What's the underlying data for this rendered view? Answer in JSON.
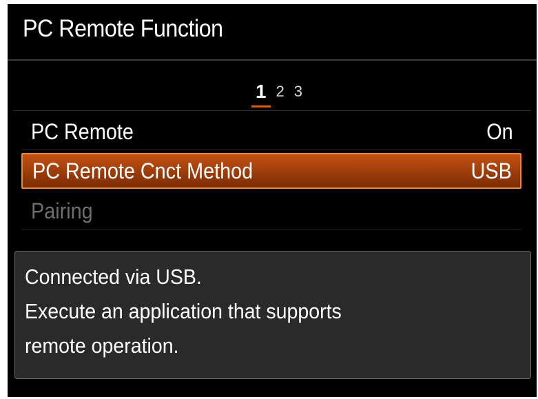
{
  "header": {
    "title": "PC Remote Function"
  },
  "pagination": {
    "pages": [
      "1",
      "2",
      "3"
    ],
    "active_page": "1"
  },
  "menu": {
    "items": [
      {
        "label": "PC Remote",
        "value": "On",
        "state": "normal"
      },
      {
        "label": "PC Remote Cnct Method",
        "value": "USB",
        "state": "selected"
      },
      {
        "label": "Pairing",
        "value": "",
        "state": "disabled"
      }
    ]
  },
  "help": {
    "lines": [
      "Connected via USB.",
      "Execute an application that supports",
      "remote operation."
    ]
  },
  "colors": {
    "background": "#000000",
    "selection": "#b3470e",
    "selection_border": "#e8873a",
    "active_page_underline": "#e05a10",
    "disabled_text": "#6e6e6e",
    "help_panel": "#2a2a2a"
  }
}
